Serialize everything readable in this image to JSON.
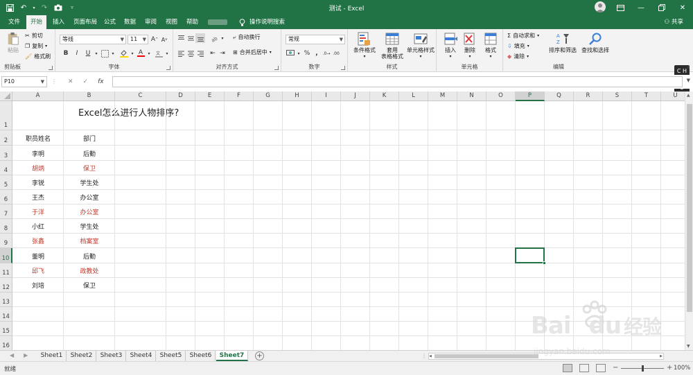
{
  "window": {
    "title": "测试 - Excel",
    "share_label": "共享"
  },
  "ribbon_tabs": [
    "文件",
    "开始",
    "插入",
    "页面布局",
    "公式",
    "数据",
    "审阅",
    "视图",
    "帮助"
  ],
  "active_tab_index": 1,
  "tell_me": "操作说明搜索",
  "clipboard": {
    "label": "剪贴板",
    "paste": "粘贴",
    "cut": "剪切",
    "copy": "复制",
    "format_painter": "格式刷"
  },
  "font": {
    "label": "字体",
    "name": "等线",
    "size": "11",
    "bold": "B",
    "italic": "I",
    "underline": "U"
  },
  "alignment": {
    "label": "对齐方式",
    "wrap_text": "自动换行",
    "merge_center": "合并后居中"
  },
  "number": {
    "label": "数字",
    "format": "常规",
    "percent": "%",
    "comma": ","
  },
  "styles": {
    "label": "样式",
    "conditional": "条件格式",
    "format_table_l1": "套用",
    "format_table_l2": "表格格式",
    "cell_styles": "单元格样式"
  },
  "cells": {
    "label": "单元格",
    "insert": "插入",
    "delete": "删除",
    "format": "格式"
  },
  "editing": {
    "label": "编辑",
    "autosum": "自动求和",
    "fill": "填充",
    "clear": "清除",
    "sort_filter": "排序和筛选",
    "find_select": "查找和选择"
  },
  "ime": {
    "line1": "C H",
    "line2": "S ⁝"
  },
  "formula_bar": {
    "name_box": "P10",
    "formula": ""
  },
  "columns": [
    "A",
    "B",
    "C",
    "D",
    "E",
    "F",
    "G",
    "H",
    "I",
    "J",
    "K",
    "L",
    "M",
    "N",
    "O",
    "P",
    "Q",
    "R",
    "S",
    "T",
    "U"
  ],
  "rows": [
    "1",
    "2",
    "3",
    "4",
    "5",
    "6",
    "7",
    "8",
    "9",
    "10",
    "11",
    "12",
    "13",
    "14",
    "15",
    "16"
  ],
  "selected": {
    "column": "P",
    "row": "10"
  },
  "sheet": {
    "title": "Excel怎么进行人物排序?",
    "headers": [
      "职员姓名",
      "部门"
    ],
    "records": [
      {
        "name": "李明",
        "dept": "后勤",
        "highlight": false
      },
      {
        "name": "胡炳",
        "dept": "保卫",
        "highlight": true
      },
      {
        "name": "李锐",
        "dept": "学生处",
        "highlight": false
      },
      {
        "name": "王杰",
        "dept": "办公室",
        "highlight": false
      },
      {
        "name": "于洋",
        "dept": "办公室",
        "highlight": true
      },
      {
        "name": "小红",
        "dept": "学生处",
        "highlight": false
      },
      {
        "name": "张鑫",
        "dept": "档案室",
        "highlight": true
      },
      {
        "name": "董明",
        "dept": "后勤",
        "highlight": false
      },
      {
        "name": "邱飞",
        "dept": "政教处",
        "highlight": true
      },
      {
        "name": "刘培",
        "dept": "保卫",
        "highlight": false
      }
    ]
  },
  "sheet_tabs": [
    "Sheet1",
    "Sheet2",
    "Sheet3",
    "Sheet4",
    "Sheet5",
    "Sheet6",
    "Sheet7"
  ],
  "active_sheet_index": 6,
  "status": {
    "ready": "就绪",
    "zoom": "100%"
  },
  "watermark": {
    "brand": "Bai",
    "brand_suffix": "du",
    "cn": "经验",
    "url": "jingyan.baidu.com"
  },
  "colors": {
    "excel_green": "#217346",
    "highlight_red": "#c0392b"
  }
}
